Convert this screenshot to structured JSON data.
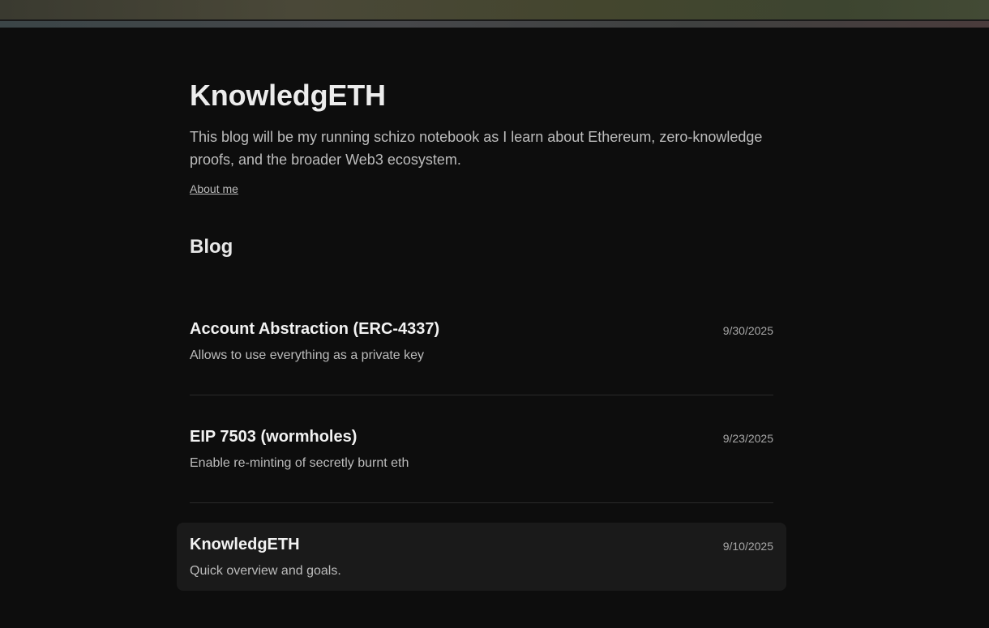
{
  "site": {
    "title": "KnowledgETH",
    "description": "This blog will be my running schizo notebook as I learn about Ethereum, zero-knowledge proofs, and the broader Web3 ecosystem.",
    "about_link": "About me"
  },
  "blog": {
    "heading": "Blog",
    "posts": [
      {
        "title": "Account Abstraction (ERC-4337)",
        "date": "9/30/2025",
        "summary": "Allows to use everything as a private key"
      },
      {
        "title": "EIP 7503 (wormholes)",
        "date": "9/23/2025",
        "summary": "Enable re-minting of secretly burnt eth"
      },
      {
        "title": "KnowledgETH",
        "date": "9/10/2025",
        "summary": "Quick overview and goals."
      }
    ]
  },
  "colors": {
    "background": "#0d0d0d",
    "hover_row": "#1a1a1a",
    "divider": "#2a2a2a"
  }
}
